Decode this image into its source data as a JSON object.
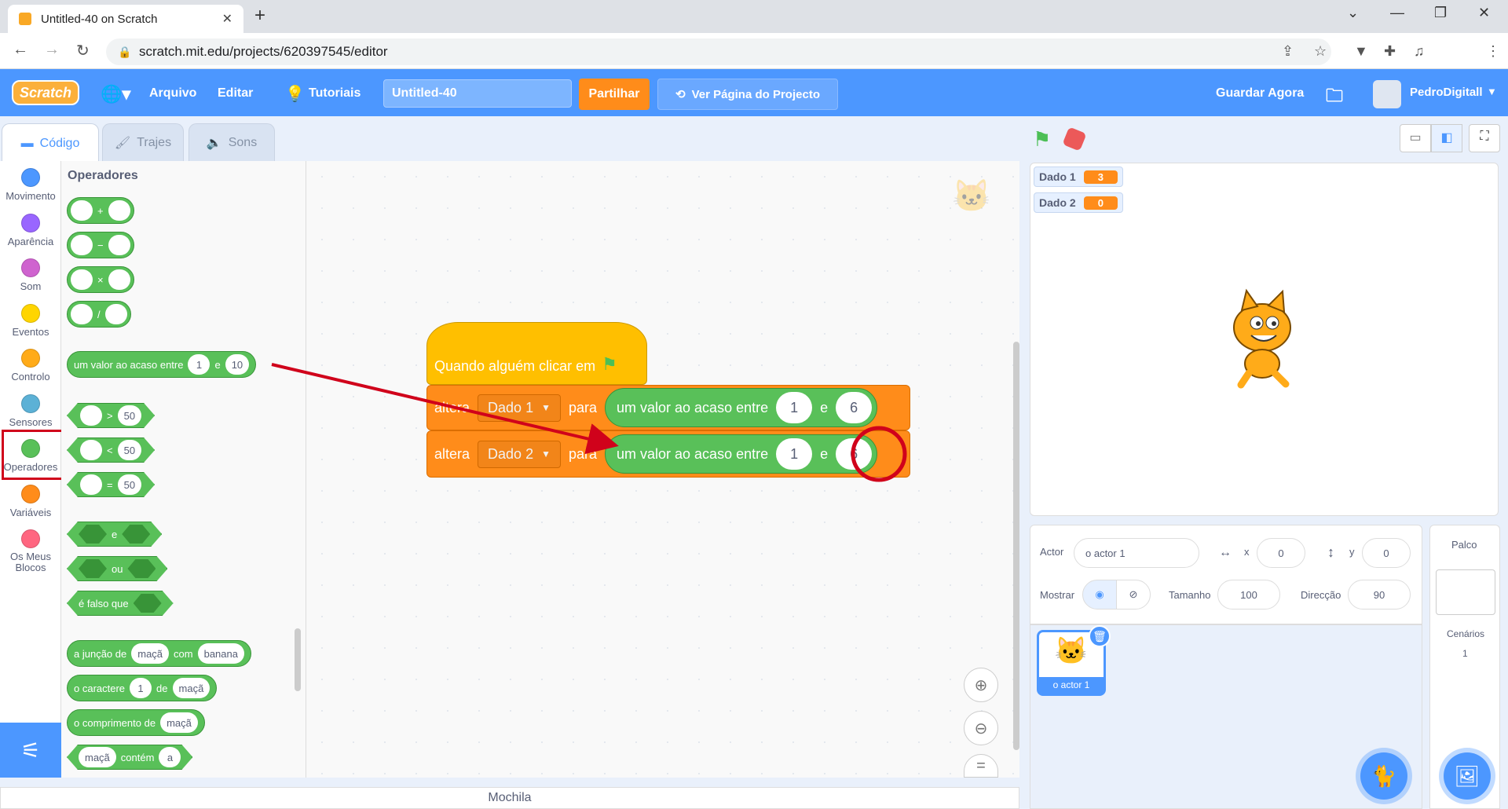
{
  "browser": {
    "tab_title": "Untitled-40 on Scratch",
    "url": "scratch.mit.edu/projects/620397545/editor"
  },
  "menu": {
    "logo": "Scratch",
    "file": "Arquivo",
    "edit": "Editar",
    "tutorials": "Tutoriais",
    "project_title": "Untitled-40",
    "share": "Partilhar",
    "see_project": "Ver Página do Projecto",
    "save_now": "Guardar Agora",
    "username": "PedroDigitall"
  },
  "editor_tabs": [
    "Código",
    "Trajes",
    "Sons"
  ],
  "categories": [
    {
      "label": "Movimento",
      "color": "#4c97ff"
    },
    {
      "label": "Aparência",
      "color": "#9966ff"
    },
    {
      "label": "Som",
      "color": "#cf63cf"
    },
    {
      "label": "Eventos",
      "color": "#ffd500"
    },
    {
      "label": "Controlo",
      "color": "#ffab19"
    },
    {
      "label": "Sensores",
      "color": "#5cb1d6"
    },
    {
      "label": "Operadores",
      "color": "#59c059"
    },
    {
      "label": "Variáveis",
      "color": "#ff8c1a"
    },
    {
      "label": "Os Meus Blocos",
      "color": "#ff6680"
    }
  ],
  "palette": {
    "title": "Operadores",
    "arith": [
      "+",
      "−",
      "×",
      "/"
    ],
    "random": {
      "text": "um valor ao acaso entre",
      "a": "1",
      "and": "e",
      "b": "10"
    },
    "compare": [
      {
        "op": ">",
        "v": "50"
      },
      {
        "op": "<",
        "v": "50"
      },
      {
        "op": "=",
        "v": "50"
      }
    ],
    "logic": [
      "e",
      "ou",
      "é falso que"
    ],
    "join": {
      "text": "a junção de",
      "a": "maçã",
      "with": "com",
      "b": "banana"
    },
    "letter": {
      "text": "o caractere",
      "n": "1",
      "of": "de",
      "s": "maçã"
    },
    "length": {
      "text": "o comprimento de",
      "s": "maçã"
    },
    "contains": {
      "a": "maçã",
      "text": "contém",
      "b": "a"
    }
  },
  "script": {
    "hat": "Quando alguém clicar em",
    "blocks": [
      {
        "verb": "altera",
        "var": "Dado 1",
        "to": "para",
        "op": "um valor ao acaso entre",
        "a": "1",
        "and": "e",
        "b": "6"
      },
      {
        "verb": "altera",
        "var": "Dado 2",
        "to": "para",
        "op": "um valor ao acaso entre",
        "a": "1",
        "and": "e",
        "b": "6"
      }
    ]
  },
  "backpack": "Mochila",
  "monitors": [
    {
      "name": "Dado 1",
      "value": "3"
    },
    {
      "name": "Dado 2",
      "value": "0"
    }
  ],
  "sprite_info": {
    "actor_label": "Actor",
    "actor_name": "o actor 1",
    "x_label": "x",
    "x": "0",
    "y_label": "y",
    "y": "0",
    "show_label": "Mostrar",
    "size_label": "Tamanho",
    "size": "100",
    "direction_label": "Direcção",
    "direction": "90"
  },
  "sprite_card": "o actor 1",
  "stage_panel": {
    "title": "Palco",
    "backdrops_label": "Cenários",
    "backdrops_count": "1"
  },
  "colors": {
    "accent": "#4c97ff",
    "operators": "#59c059",
    "variables": "#ff8c1a",
    "events": "#ffbf00",
    "annotation": "#d0021b"
  }
}
